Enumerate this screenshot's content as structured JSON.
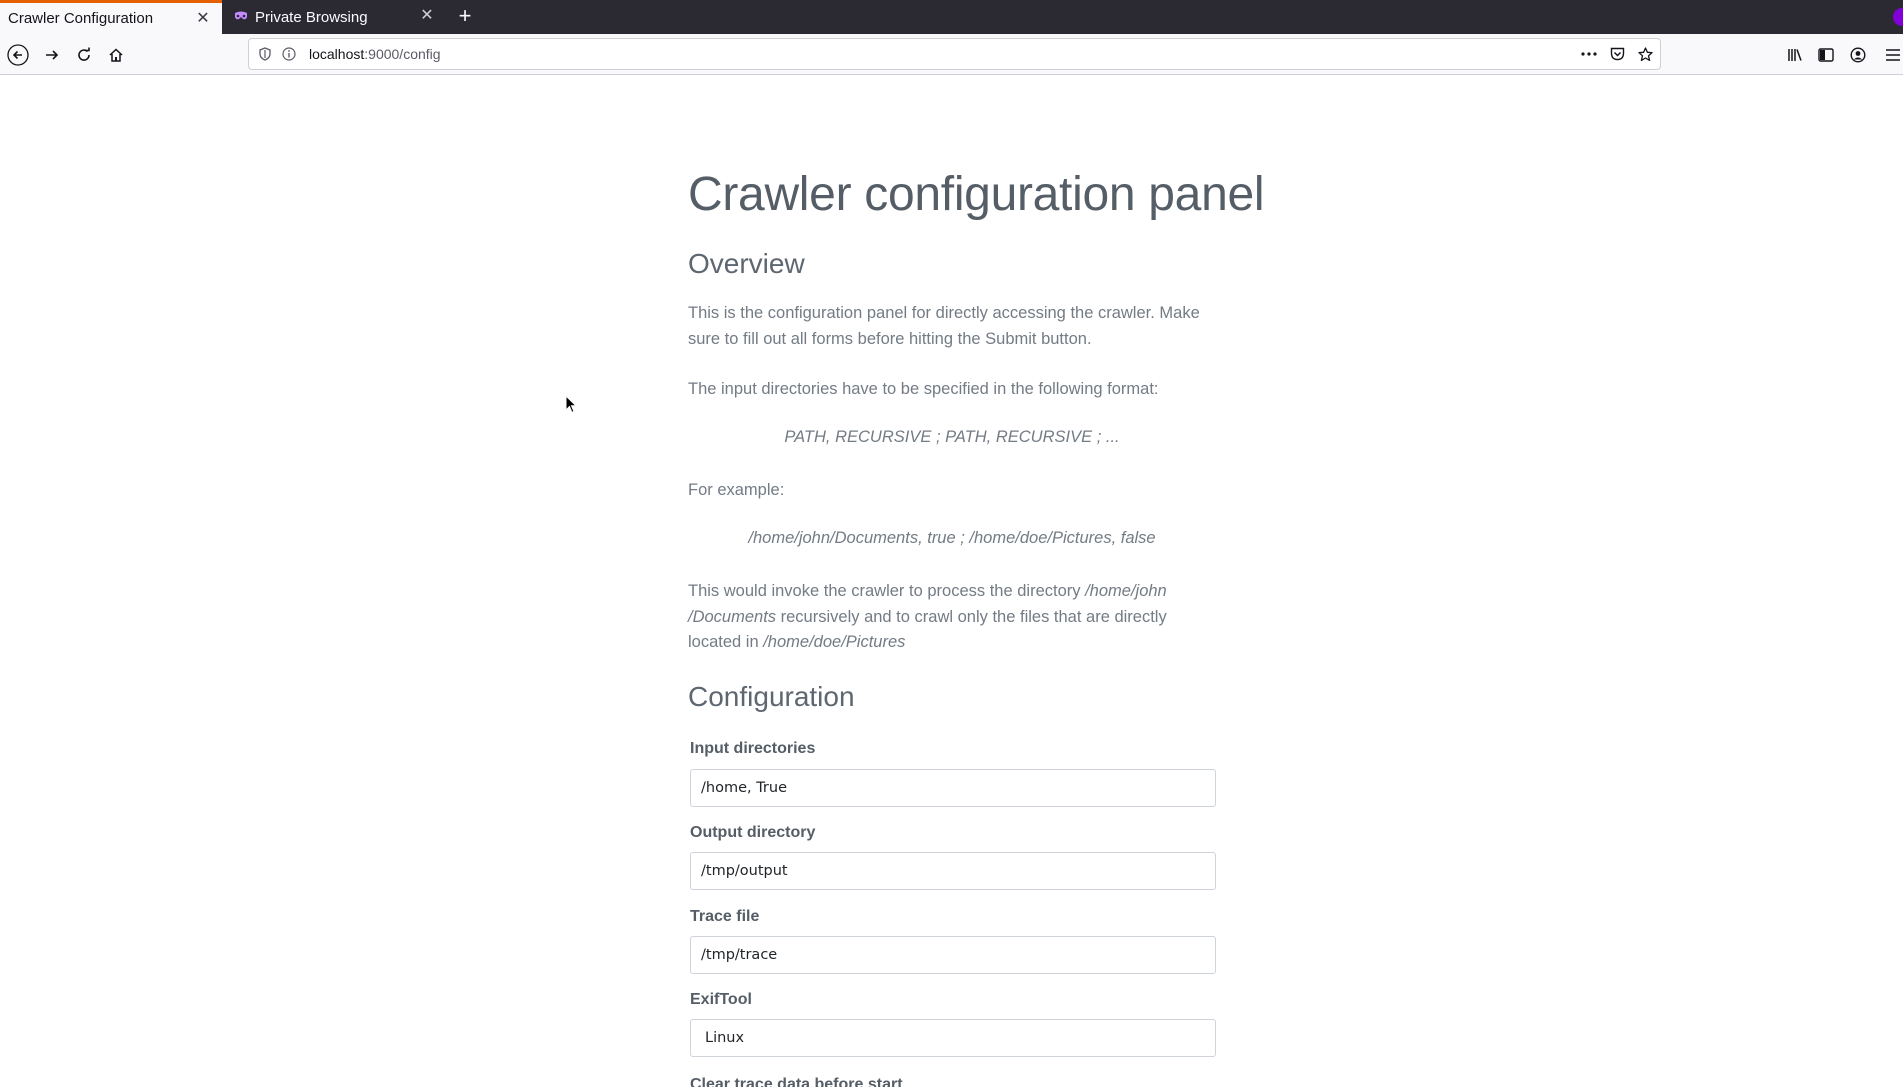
{
  "browser": {
    "tabs": [
      {
        "label": "Crawler Configuration",
        "active": true
      },
      {
        "label": "Private Browsing",
        "active": false
      }
    ],
    "url_host": "localhost",
    "url_path": ":9000/config",
    "accent_color": "#e66000",
    "private_color": "#8000d7"
  },
  "page": {
    "title": "Crawler configuration panel",
    "overview_heading": "Overview",
    "intro": "This is the configuration panel for directly accessing the crawler. Make sure to fill out all forms before hitting the Submit button.",
    "format_intro": "The input directories have to be specified in the following format:",
    "format": "PATH, RECURSIVE ; PATH, RECURSIVE ; ...",
    "example_intro": "For example:",
    "example": "/home/john/Documents, true ; /home/doe/Pictures, false",
    "explain_1": "This would invoke the crawler to process the directory ",
    "explain_dir1": "/home/john /Documents",
    "explain_2": " recursively and to crawl only the files that are directly located in ",
    "explain_dir2": "/home/doe/Pictures",
    "config_heading": "Configuration",
    "fields": {
      "input_dirs_label": "Input directories",
      "input_dirs_value": "/home, True",
      "output_dir_label": "Output directory",
      "output_dir_value": "/tmp/output",
      "trace_label": "Trace file",
      "trace_value": "/tmp/trace",
      "exif_label": "ExifTool",
      "exif_value": "Linux",
      "clear_label": "Clear trace data before start"
    }
  }
}
